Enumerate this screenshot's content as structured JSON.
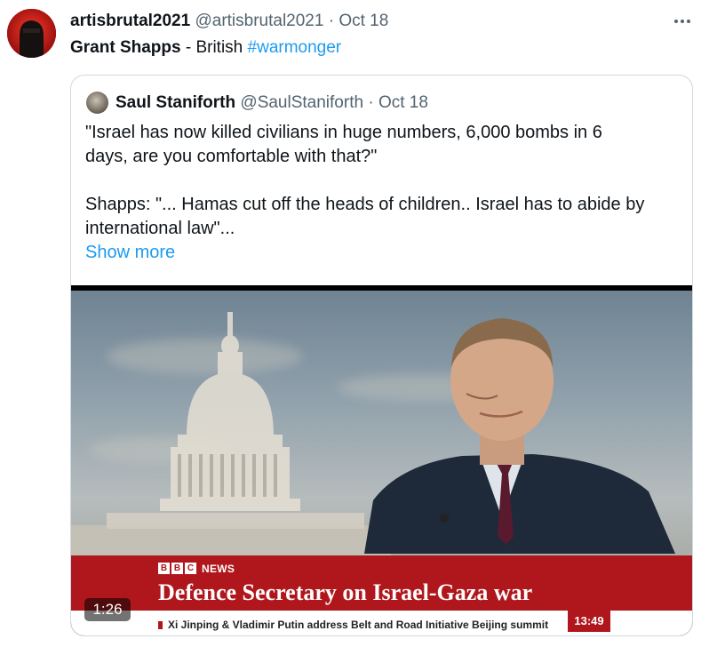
{
  "tweet": {
    "author_name": "artisbrutal2021",
    "author_handle": "@artisbrutal2021",
    "separator": "·",
    "date": "Oct 18",
    "more_icon": "more-horizontal-icon",
    "text_bold": "Grant Shapps",
    "text_plain": " - British ",
    "hashtag": "#warmonger"
  },
  "quote": {
    "author_name": "Saul Staniforth",
    "author_handle": "@SaulStaniforth",
    "separator": "·",
    "date": "Oct 18",
    "lines": [
      "\"Israel has now killed civilians in huge numbers, 6,000 bombs in 6",
      "days, are you comfortable with that?\"",
      "Shapps: \"... Hamas cut off the heads of children.. Israel has to abide by",
      "international law\"..."
    ],
    "show_more": "Show more"
  },
  "video": {
    "brand": "NEWS",
    "headline": "Defence Secretary on Israel-Gaza war",
    "ticker": "Xi Jinping & Vladimir Putin address Belt and Road Initiative Beijing summit",
    "clock": "13:49",
    "duration": "1:26"
  },
  "colors": {
    "accent": "#1d9bf0",
    "bbc_red": "#b0171c",
    "muted": "#536471"
  }
}
